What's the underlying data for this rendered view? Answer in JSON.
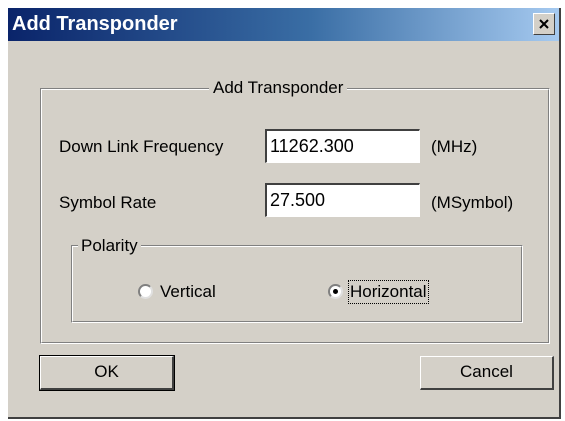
{
  "window": {
    "title": "Add Transponder"
  },
  "group": {
    "legend": "Add Transponder"
  },
  "fields": {
    "downlink": {
      "label": "Down Link Frequency",
      "value": "11262.300",
      "unit": "(MHz)"
    },
    "symbol_rate": {
      "label": "Symbol Rate",
      "value": "27.500",
      "unit": "(MSymbol)"
    }
  },
  "polarity": {
    "legend": "Polarity",
    "options": [
      {
        "label": "Vertical",
        "selected": false
      },
      {
        "label": "Horizontal",
        "selected": true
      }
    ]
  },
  "buttons": {
    "ok": "OK",
    "cancel": "Cancel"
  },
  "icons": {
    "close": "close-icon"
  }
}
